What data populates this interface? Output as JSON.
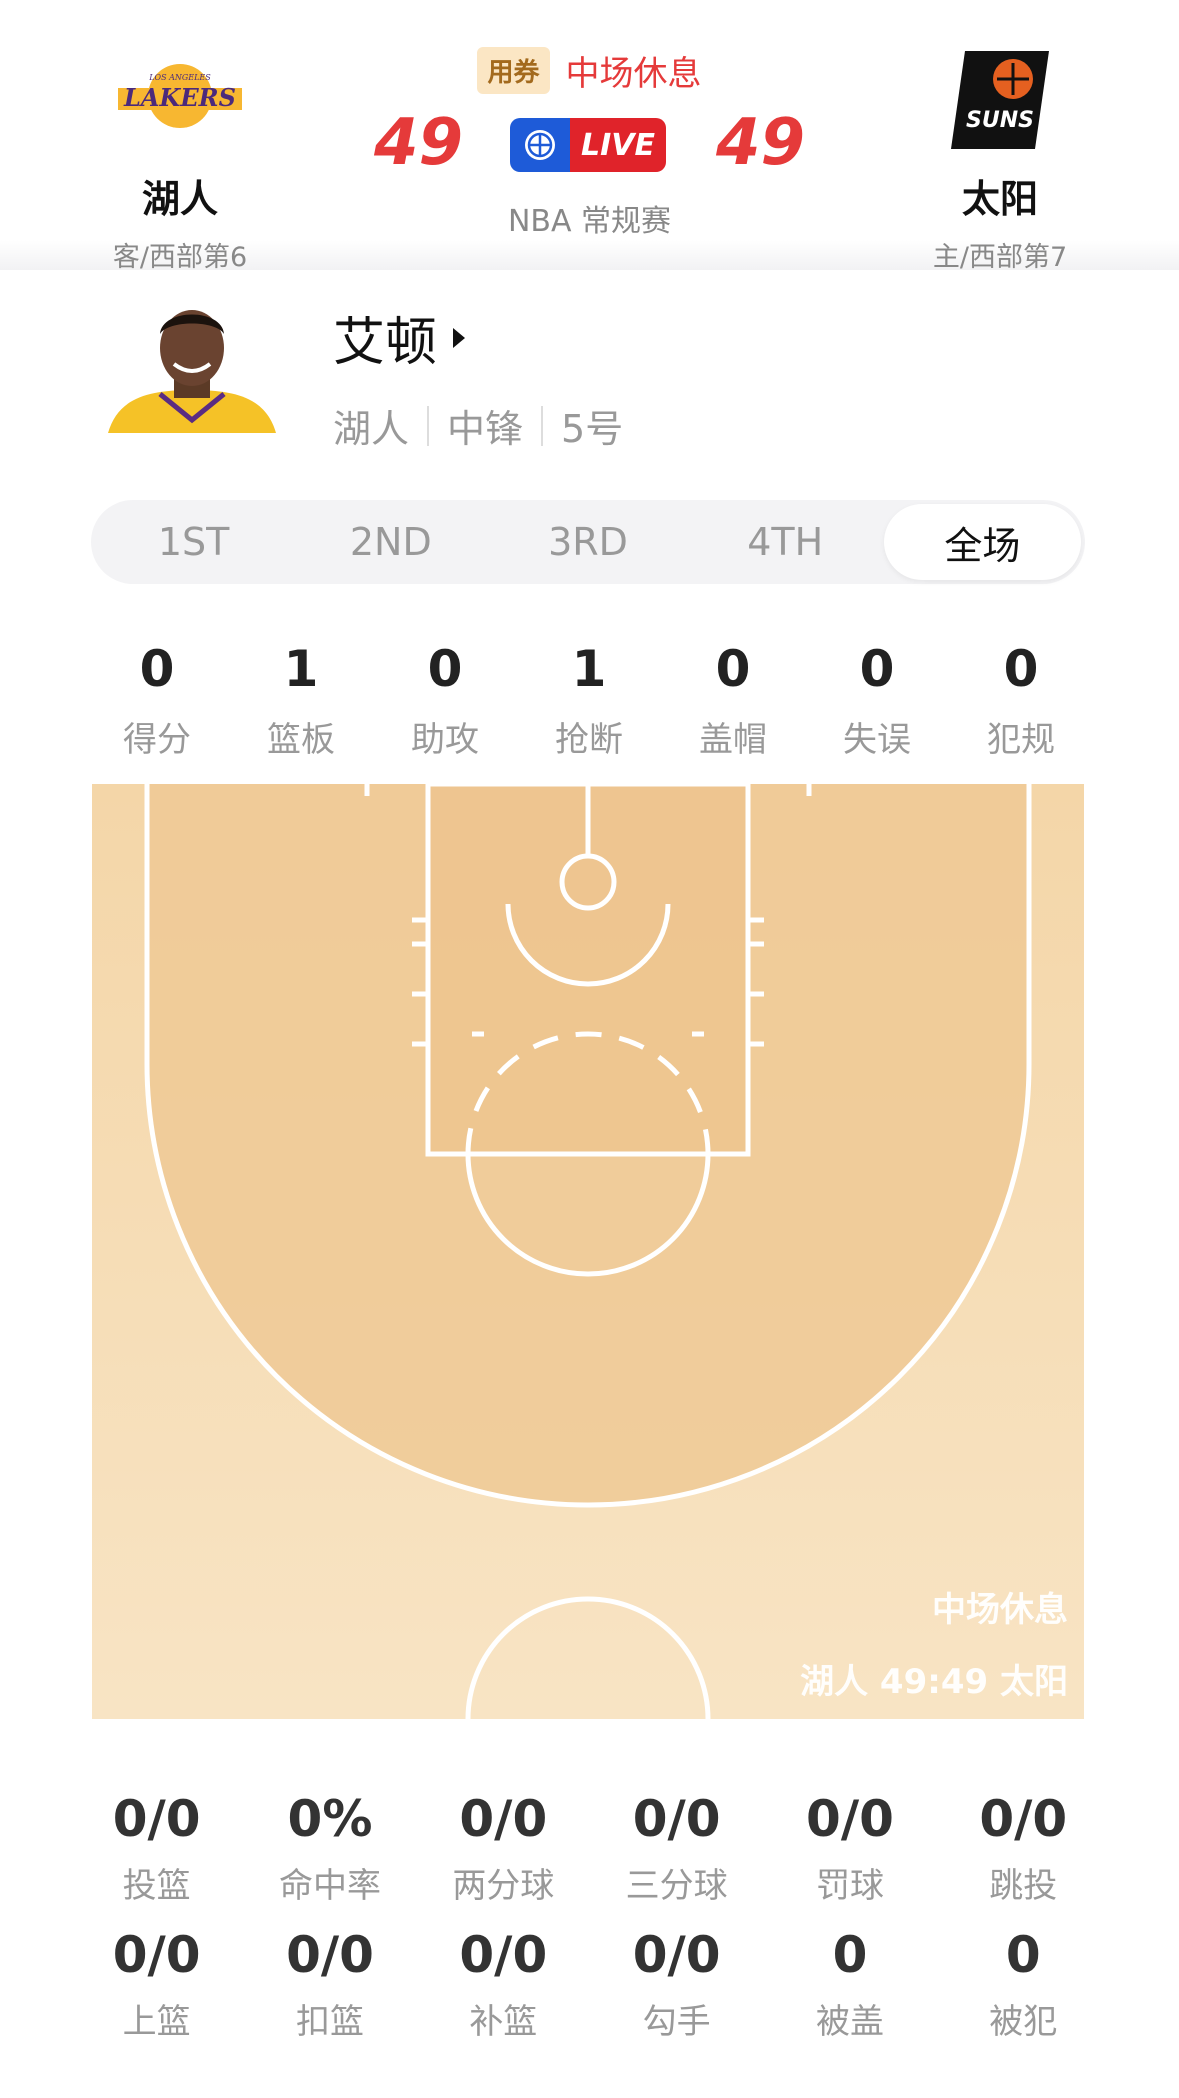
{
  "header": {
    "away": {
      "name": "湖人",
      "sub": "客/西部第6",
      "logo": "lakers-logo"
    },
    "home": {
      "name": "太阳",
      "sub": "主/西部第7",
      "logo": "suns-logo"
    },
    "coupon": "用券",
    "status": "中场休息",
    "away_score": "49",
    "home_score": "49",
    "live": "LIVE",
    "league": "NBA 常规赛"
  },
  "player": {
    "name": "艾顿",
    "team": "湖人",
    "position": "中锋",
    "number": "5号"
  },
  "tabs": [
    "1ST",
    "2ND",
    "3RD",
    "4TH",
    "全场"
  ],
  "active_tab": "全场",
  "summary": [
    {
      "value": "0",
      "label": "得分"
    },
    {
      "value": "1",
      "label": "篮板"
    },
    {
      "value": "0",
      "label": "助攻"
    },
    {
      "value": "1",
      "label": "抢断"
    },
    {
      "value": "0",
      "label": "盖帽"
    },
    {
      "value": "0",
      "label": "失误"
    },
    {
      "value": "0",
      "label": "犯规"
    }
  ],
  "court": {
    "status": "中场休息",
    "score_line": "湖人 49:49 太阳"
  },
  "shooting_row1": [
    {
      "value": "0/0",
      "label": "投篮"
    },
    {
      "value": "0%",
      "label": "命中率"
    },
    {
      "value": "0/0",
      "label": "两分球"
    },
    {
      "value": "0/0",
      "label": "三分球"
    },
    {
      "value": "0/0",
      "label": "罚球"
    },
    {
      "value": "0/0",
      "label": "跳投"
    }
  ],
  "shooting_row2": [
    {
      "value": "0/0",
      "label": "上篮"
    },
    {
      "value": "0/0",
      "label": "扣篮"
    },
    {
      "value": "0/0",
      "label": "补篮"
    },
    {
      "value": "0/0",
      "label": "勾手"
    },
    {
      "value": "0",
      "label": "被盖"
    },
    {
      "value": "0",
      "label": "被犯"
    }
  ],
  "colors": {
    "score": "#e53a3a",
    "live_red": "#e0232a",
    "live_blue": "#1e5bd8",
    "court_light": "#f6dfb8",
    "court_dark": "#efc995"
  }
}
